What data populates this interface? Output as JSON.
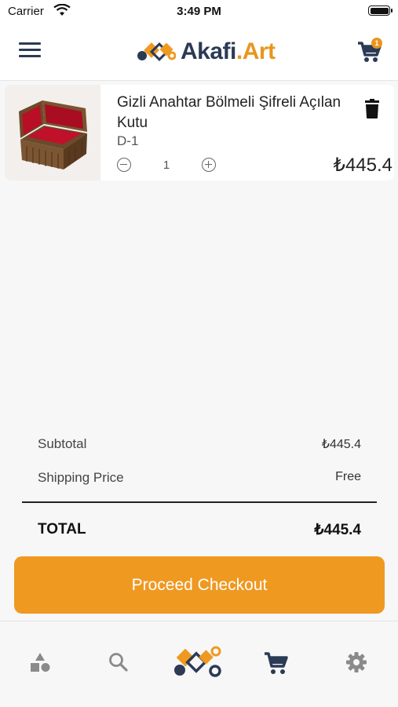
{
  "status_bar": {
    "carrier": "Carrier",
    "time": "3:49 PM"
  },
  "header": {
    "logo_text_main": "Akafi",
    "logo_text_dot": ".",
    "logo_text_suffix": "Art",
    "cart_badge": "1"
  },
  "cart": {
    "items": [
      {
        "name": "Gizli Anahtar Bölmeli Şifreli Açılan Kutu",
        "variant": "D-1",
        "quantity": "1",
        "price": "₺445.4"
      }
    ]
  },
  "summary": {
    "subtotal_label": "Subtotal",
    "subtotal_value": "₺445.4",
    "shipping_label": "Shipping Price",
    "shipping_value": "Free",
    "total_label": "TOTAL",
    "total_value": "₺445.4"
  },
  "checkout_button": "Proceed Checkout",
  "colors": {
    "accent": "#ef9921",
    "brand_navy": "#2b3a55"
  },
  "tabbar": {
    "tabs": [
      {
        "icon": "categories-icon",
        "active": false
      },
      {
        "icon": "search-icon",
        "active": false
      },
      {
        "icon": "home-logo-icon",
        "active": false
      },
      {
        "icon": "cart-icon",
        "active": true
      },
      {
        "icon": "settings-icon",
        "active": false
      }
    ]
  }
}
